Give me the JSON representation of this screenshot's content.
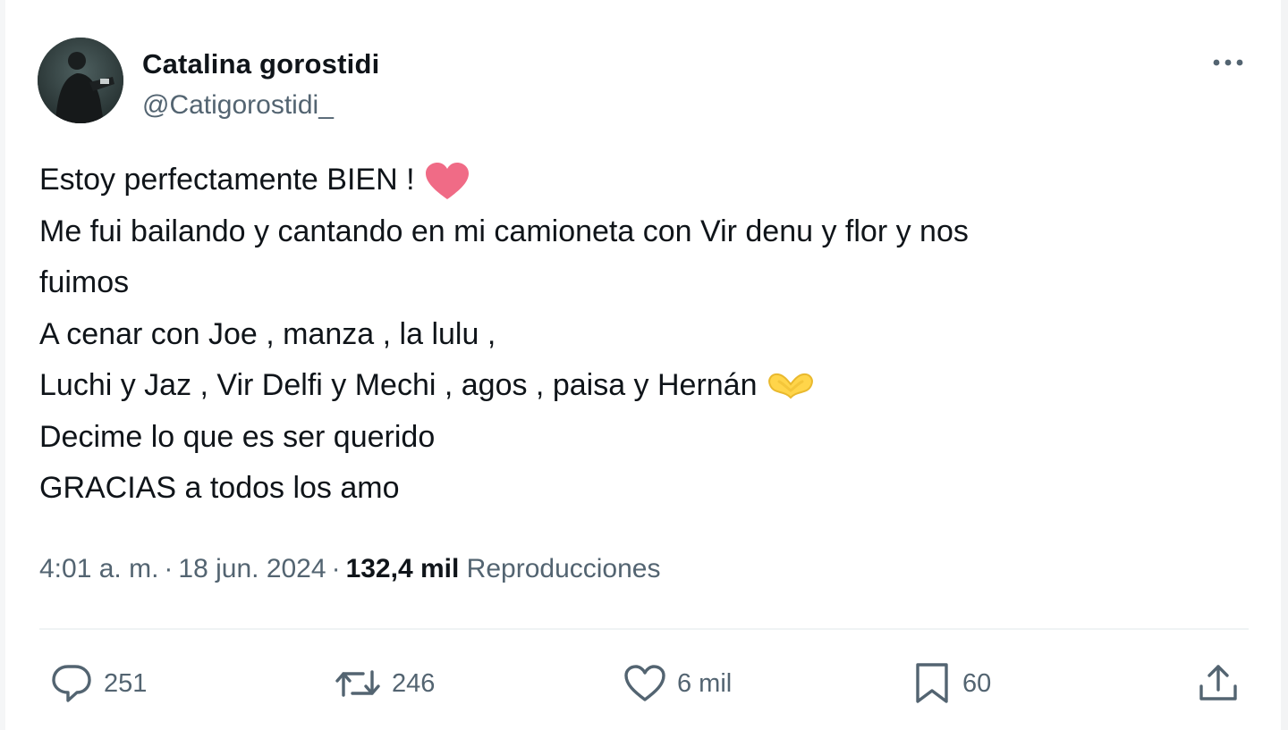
{
  "author": {
    "name": "Catalina gorostidi",
    "handle": "@Catigorostidi_"
  },
  "tweet": {
    "lines": [
      "Estoy perfectamente BIEN !",
      "Me fui bailando y cantando en mi camioneta con Vir denu y flor y nos",
      "fuimos",
      "A cenar con Joe , manza , la lulu ,",
      "Luchi y Jaz , Vir Delfi y Mechi , agos , paisa y Hernán",
      "Decime lo que es ser querido",
      "GRACIAS a todos los amo"
    ],
    "emojis": {
      "line1": "red-heart-emoji",
      "line5": "heart-hands-emoji"
    }
  },
  "meta": {
    "time": "4:01 a. m.",
    "separator": "·",
    "date": "18 jun. 2024",
    "views_count": "132,4 mil",
    "views_label": "Reproducciones"
  },
  "actions": {
    "replies": "251",
    "reposts": "246",
    "likes": "6 mil",
    "bookmarks": "60"
  },
  "icons": {
    "reply": "speech-bubble-icon",
    "repost": "repost-arrows-icon",
    "like": "heart-outline-icon",
    "bookmark": "bookmark-icon",
    "share": "share-upload-icon",
    "more": "more-dots-icon"
  },
  "colors": {
    "text_primary": "#0f1419",
    "text_secondary": "#536471",
    "heart_emoji": "#f06b86",
    "hands_emoji": "#ffd54a",
    "divider": "#eff3f4"
  }
}
